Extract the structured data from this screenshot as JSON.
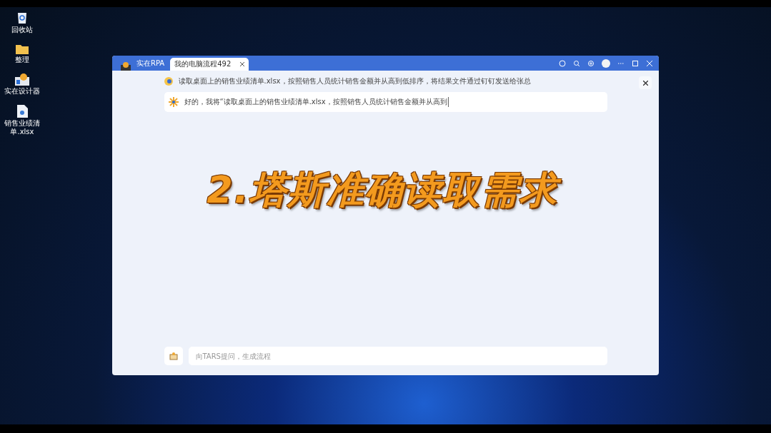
{
  "desktop_icons": [
    {
      "label": "回收站",
      "kind": "bin"
    },
    {
      "label": "整理",
      "kind": "folder"
    },
    {
      "label": "实在设计器",
      "kind": "app"
    },
    {
      "label": "销售业绩清单.xlsx",
      "kind": "file"
    }
  ],
  "window": {
    "app_name": "实在RPA",
    "tabs": [
      {
        "label": "我的电脑流程492",
        "selected": true
      }
    ]
  },
  "chat": {
    "request": "读取桌面上的销售业绩清单.xlsx，按照销售人员统计销售金额并从高到低排序，将结果文件通过钉钉发送给张总",
    "reply": "好的，我将“读取桌面上的销售业绩清单.xlsx，按照销售人员统计销售金额并从高到",
    "input": {
      "placeholder": "向TARS提问，生成流程"
    }
  },
  "caption": "2.塔斯准确读取需求"
}
